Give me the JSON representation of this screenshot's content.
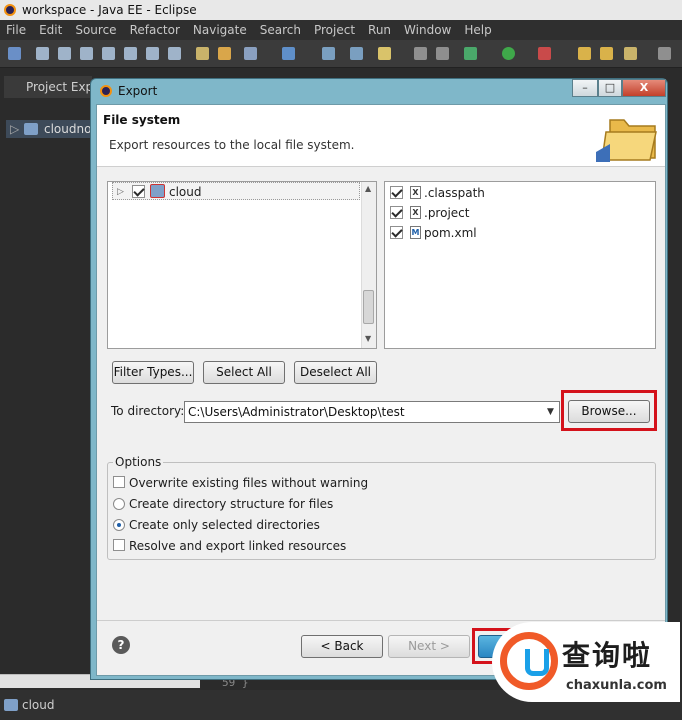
{
  "window": {
    "title": "workspace - Java EE - Eclipse"
  },
  "menubar": [
    "File",
    "Edit",
    "Source",
    "Refactor",
    "Navigate",
    "Search",
    "Project",
    "Run",
    "Window",
    "Help"
  ],
  "left_panel": {
    "tab_label": "Project Explorer",
    "tree_item": "cloudnote"
  },
  "status_bar": {
    "text": "cloud"
  },
  "editor": {
    "line_number": "59",
    "line_text": "}"
  },
  "dialog": {
    "title": "Export",
    "window_buttons": {
      "minimize": "–",
      "maximize": "□",
      "close": "X"
    },
    "header_title": "File system",
    "header_description": "Export resources to the local file system.",
    "project_tree": [
      {
        "label": "cloud",
        "checked": true
      }
    ],
    "file_list": [
      {
        "label": ".classpath",
        "icon": "X",
        "checked": true
      },
      {
        "label": ".project",
        "icon": "X",
        "checked": true
      },
      {
        "label": "pom.xml",
        "icon": "M",
        "checked": true
      }
    ],
    "buttons": {
      "filter_types": "Filter Types...",
      "select_all": "Select All",
      "deselect_all": "Deselect All",
      "browse": "Browse...",
      "back": "< Back",
      "next": "Next >"
    },
    "to_directory": {
      "label": "To directory:",
      "value": "C:\\Users\\Administrator\\Desktop\\test"
    },
    "options": {
      "legend": "Options",
      "overwrite": {
        "label": "Overwrite existing files without warning",
        "checked": false
      },
      "create_structure": {
        "label": "Create directory structure for files",
        "selected": false
      },
      "create_selected": {
        "label": "Create only selected directories",
        "selected": true
      },
      "resolve_linked": {
        "label": "Resolve and export linked resources",
        "checked": false
      }
    },
    "help": "?"
  },
  "watermark": {
    "cn": "查询啦",
    "url": "chaxunla.com"
  },
  "colors": {
    "highlight_box": "#d4121b",
    "dialog_frame": "#7fb7c9"
  }
}
